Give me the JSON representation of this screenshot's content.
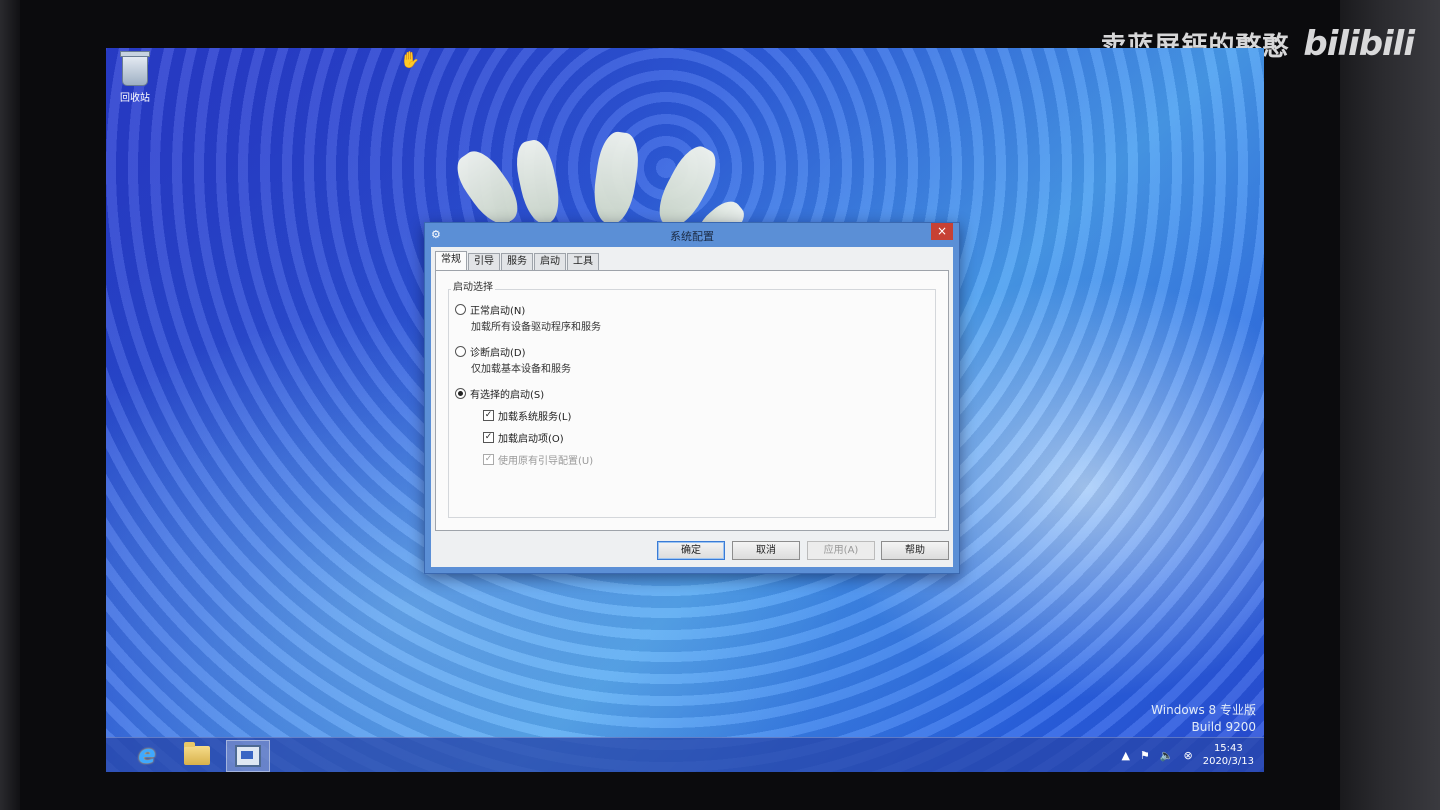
{
  "watermark": {
    "text": "卖蓝屏钙的憨憨",
    "logo": "bilibili"
  },
  "desktop": {
    "recycle_bin_label": "回收站",
    "edition": "Windows 8 专业版",
    "build": "Build 9200"
  },
  "dialog": {
    "title": "系统配置",
    "close_glyph": "×",
    "tabs": [
      "常规",
      "引导",
      "服务",
      "启动",
      "工具"
    ],
    "group_title": "启动选择",
    "options": {
      "normal": {
        "label": "正常启动(N)",
        "desc": "加载所有设备驱动程序和服务"
      },
      "diagnostic": {
        "label": "诊断启动(D)",
        "desc": "仅加载基本设备和服务"
      },
      "selective": {
        "label": "有选择的启动(S)"
      }
    },
    "checks": {
      "load_services": "加载系统服务(L)",
      "load_startup": "加载启动项(O)",
      "use_boot_config": "使用原有引导配置(U)"
    },
    "buttons": {
      "ok": "确定",
      "cancel": "取消",
      "apply": "应用(A)",
      "help": "帮助"
    }
  },
  "taskbar": {
    "icons": [
      "internet-explorer-icon",
      "file-explorer-icon",
      "system-config-icon"
    ],
    "clock_time": "15:43",
    "clock_date": "2020/3/13"
  },
  "colors": {
    "close_button": "#c74134",
    "title_bar": "#5b8fd6",
    "taskbar": "#2846aa"
  }
}
